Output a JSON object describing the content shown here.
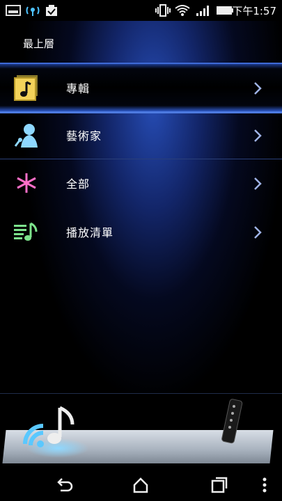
{
  "status_bar": {
    "time": "下午1:57",
    "icons": [
      "notification-image-icon",
      "wireless-tether-icon",
      "task-check-icon",
      "vibrate-icon",
      "wifi-icon",
      "signal-icon",
      "battery-icon"
    ]
  },
  "header": {
    "title": "最上層"
  },
  "menu": {
    "items": [
      {
        "label": "專輯",
        "icon": "album-icon",
        "selected": true
      },
      {
        "label": "藝術家",
        "icon": "artist-icon",
        "selected": false
      },
      {
        "label": "全部",
        "icon": "all-icon",
        "selected": false
      },
      {
        "label": "播放清單",
        "icon": "playlist-icon",
        "selected": false
      }
    ]
  },
  "bottom_panel": {
    "icons": [
      "wireless-music-icon",
      "remote-control-icon"
    ]
  },
  "nav_bar": {
    "icons": [
      "back-icon",
      "home-icon",
      "recent-apps-icon",
      "menu-icon"
    ]
  },
  "colors": {
    "accent": "#4d7ae0",
    "background": "#000000",
    "chevron": "#9fb3e6"
  }
}
